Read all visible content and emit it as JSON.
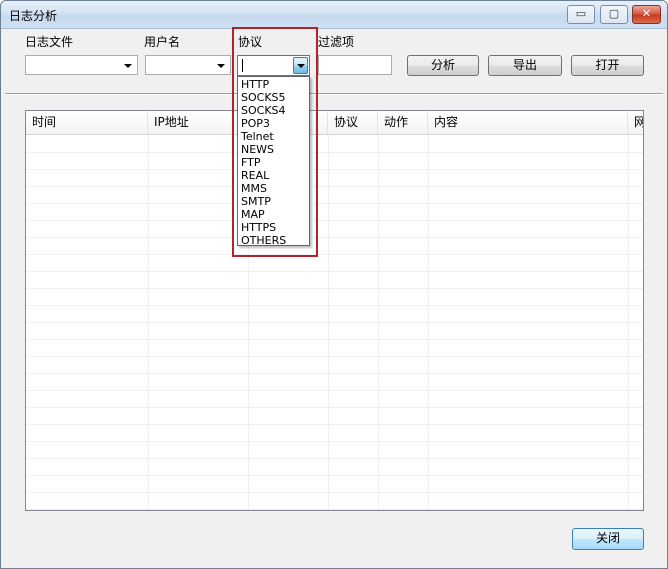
{
  "window": {
    "title": "日志分析",
    "controls": {
      "minimize": "▭",
      "maximize": "▢",
      "close": "✕"
    }
  },
  "toolbar": {
    "log_file_label": "日志文件",
    "username_label": "用户名",
    "protocol_label": "协议",
    "filter_label": "过滤项",
    "log_file_value": "",
    "username_value": "",
    "protocol_value": "",
    "filter_value": "",
    "analyze_button": "分析",
    "export_button": "导出",
    "open_button": "打开"
  },
  "protocol_dropdown": {
    "options": [
      "HTTP",
      "SOCKS5",
      "SOCKS4",
      "POP3",
      "Telnet",
      "NEWS",
      "FTP",
      "REAL",
      "MMS",
      "SMTP",
      "MAP",
      "HTTPS",
      "OTHERS"
    ]
  },
  "table": {
    "columns": [
      "时间",
      "IP地址",
      "",
      "协议",
      "动作",
      "内容",
      "网"
    ],
    "rows": []
  },
  "footer": {
    "close_button": "关闭"
  },
  "colors": {
    "highlight_border": "#b3242a",
    "focus_blue": "#3c7fb1"
  }
}
